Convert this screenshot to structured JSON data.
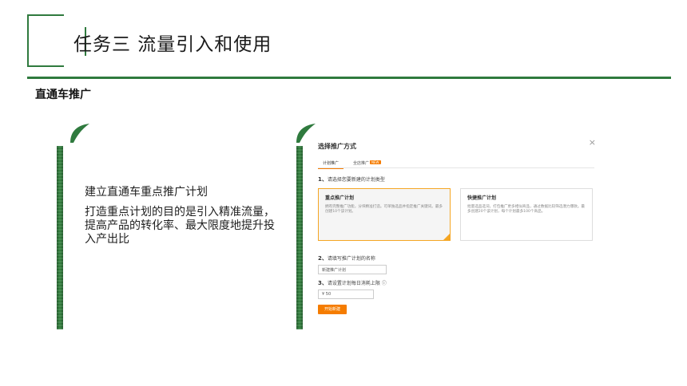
{
  "slide": {
    "title": "任务三 流量引入和使用",
    "section_heading": "直通车推广"
  },
  "left_text": {
    "line1": "建立直通车重点推广计划",
    "line2": "打造重点计划的目的是引入精准流量，提高产品的转化率、最大限度地提升投入产出比"
  },
  "panel": {
    "title": "选择推广方式",
    "close_glyph": "×",
    "tabs": [
      {
        "label": "计划推广"
      },
      {
        "label": "全店推广",
        "badge": "NEW"
      }
    ],
    "step1": {
      "num": "1、",
      "label": "请选择您要新建的计划类型"
    },
    "card_a": {
      "title": "重点推广计划",
      "desc": "拥有完整推广功能，分块精准打造。可单独选品并指定推广关键词。最多创建10个该计划。"
    },
    "card_b": {
      "title": "快捷推广计划",
      "desc": "批量选品选词，打包推广更多相似商品，通过数据比较筛选潜力爆款。最多创建20个该计划，每个计划最多100个商品。"
    },
    "step2": {
      "num": "2、",
      "label": "请填写推广计划的名称"
    },
    "name_input": "新建推广计划",
    "step3": {
      "num": "3、",
      "label": "请设置计划每日消耗上限"
    },
    "info_icon": "ⓘ",
    "budget_input": "¥ 50",
    "start_button": "开始新建"
  },
  "colors": {
    "accent_green": "#2f7a3e",
    "accent_orange": "#f57c00"
  }
}
